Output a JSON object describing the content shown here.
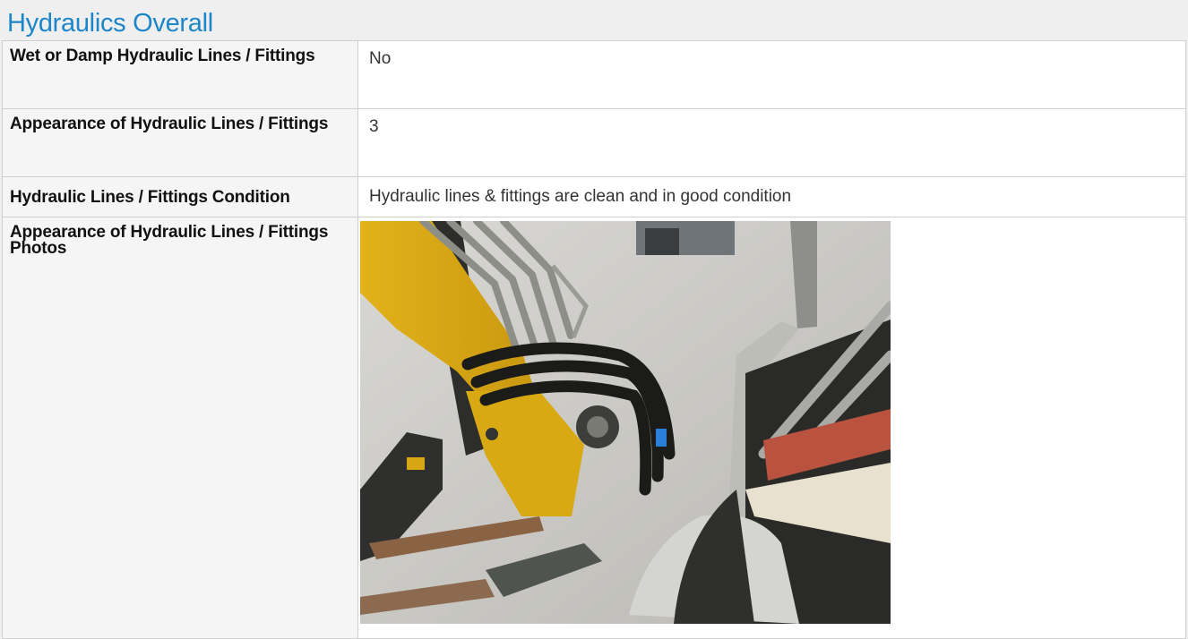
{
  "section": {
    "title": "Hydraulics Overall"
  },
  "rows": [
    {
      "label": "Wet or Damp Hydraulic Lines / Fittings",
      "value": "No"
    },
    {
      "label": "Appearance of Hydraulic Lines / Fittings",
      "value": "3"
    },
    {
      "label": "Hydraulic Lines / Fittings Condition",
      "value": "Hydraulic lines & fittings are clean and in good condition"
    },
    {
      "label": "Appearance of Hydraulic Lines / Fittings Photos",
      "value": ""
    }
  ],
  "photo": {
    "subject": "excavator-hydraulic-lines"
  },
  "colors": {
    "title": "#1c86c8",
    "label_bg": "#f5f5f5",
    "border": "#cfcfcf"
  }
}
